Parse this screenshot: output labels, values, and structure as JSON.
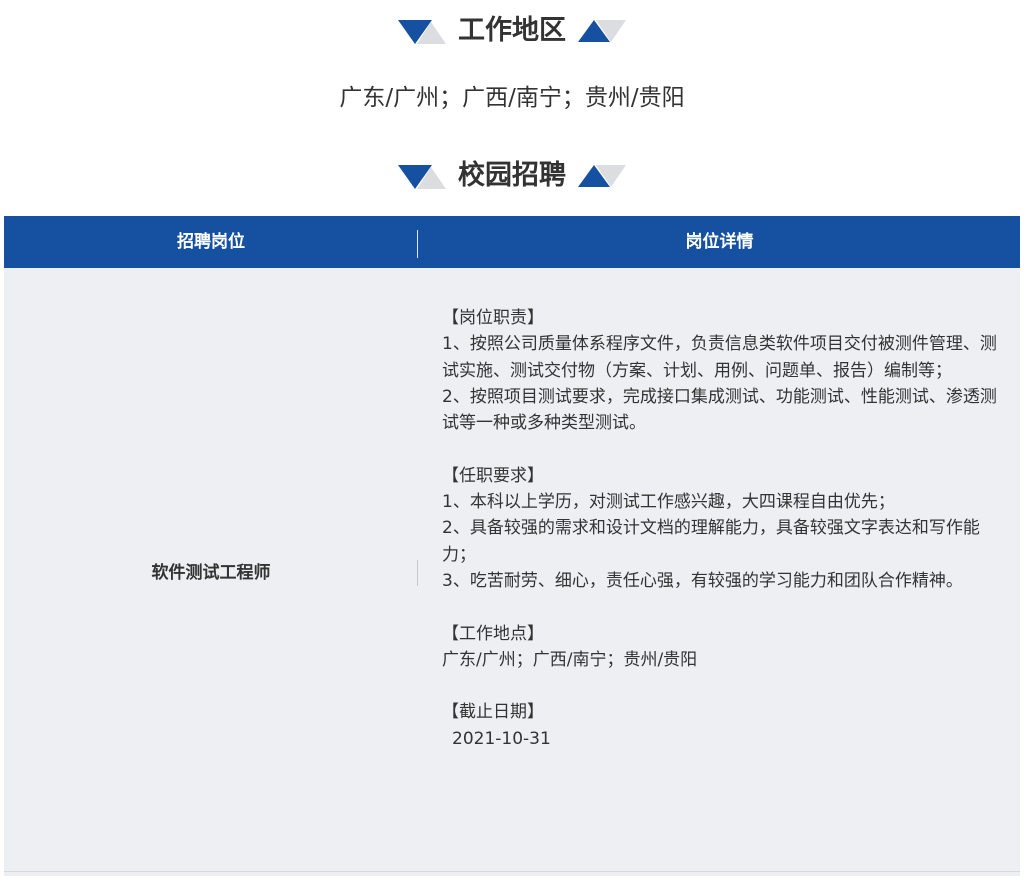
{
  "section_work_area": {
    "title": "工作地区",
    "content": "广东/广州；广西/南宁；贵州/贵阳"
  },
  "section_campus": {
    "title": "校园招聘"
  },
  "table": {
    "header": {
      "col_position": "招聘岗位",
      "col_details": "岗位详情"
    },
    "row": {
      "position": "软件测试工程师",
      "duties_title": "【岗位职责】",
      "duties": [
        "1、按照公司质量体系程序文件，负责信息类软件项目交付被测件管理、测试实施、测试交付物（方案、计划、用例、问题单、报告）编制等；",
        "2、按照项目测试要求，完成接口集成测试、功能测试、性能测试、渗透测试等一种或多种类型测试。"
      ],
      "requirements_title": "【任职要求】",
      "requirements": [
        "1、本科以上学历，对测试工作感兴趣，大四课程自由优先；",
        "2、具备较强的需求和设计文档的理解能力，具备较强文字表达和写作能力；",
        "3、吃苦耐劳、细心，责任心强，有较强的学习能力和团队合作精神。"
      ],
      "location_title": "【工作地点】",
      "location": "广东/广州；广西/南宁；贵州/贵阳",
      "deadline_title": "【截止日期】",
      "deadline": "2021-10-31"
    }
  },
  "colors": {
    "brand_blue": "#1650a0",
    "light_gray": "#dcdde1",
    "table_bg": "#eeeff3"
  }
}
